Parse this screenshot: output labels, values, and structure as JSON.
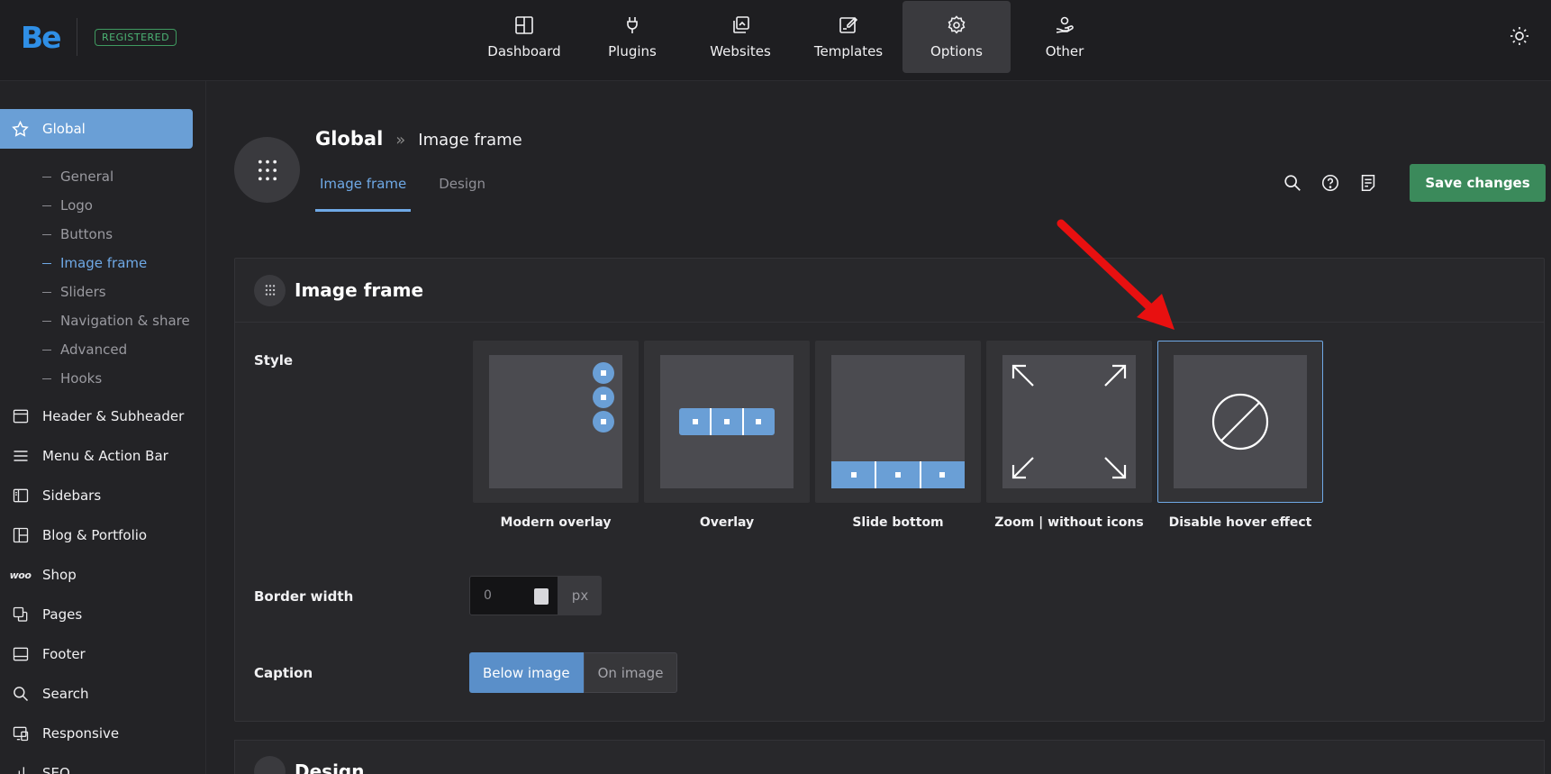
{
  "brand": {
    "logo": "Be",
    "badge": "REGISTERED"
  },
  "nav": [
    {
      "label": "Dashboard",
      "icon": "dashboard-icon"
    },
    {
      "label": "Plugins",
      "icon": "plug-icon"
    },
    {
      "label": "Websites",
      "icon": "websites-icon"
    },
    {
      "label": "Templates",
      "icon": "templates-icon"
    },
    {
      "label": "Options",
      "icon": "gear-icon",
      "active": true
    },
    {
      "label": "Other",
      "icon": "user-hand-icon"
    }
  ],
  "sidebar": {
    "global": {
      "label": "Global",
      "icon": "star-icon"
    },
    "sub_items": [
      "General",
      "Logo",
      "Buttons",
      "Image frame",
      "Sliders",
      "Navigation & share",
      "Advanced",
      "Hooks"
    ],
    "active_sub": "Image frame",
    "items": [
      {
        "label": "Header & Subheader",
        "icon": "header-icon"
      },
      {
        "label": "Menu & Action Bar",
        "icon": "menu-icon"
      },
      {
        "label": "Sidebars",
        "icon": "sidebar-icon"
      },
      {
        "label": "Blog & Portfolio",
        "icon": "layout-icon"
      },
      {
        "label": "Shop",
        "icon": "woo-icon",
        "prefix": "woo"
      },
      {
        "label": "Pages",
        "icon": "pages-icon"
      },
      {
        "label": "Footer",
        "icon": "footer-icon"
      },
      {
        "label": "Search",
        "icon": "search-icon"
      },
      {
        "label": "Responsive",
        "icon": "responsive-icon"
      },
      {
        "label": "SEO",
        "icon": "seo-icon"
      }
    ]
  },
  "header": {
    "breadcrumb_main": "Global",
    "breadcrumb_sep": "»",
    "breadcrumb_sub": "Image frame",
    "tabs": [
      {
        "label": "Image frame",
        "active": true
      },
      {
        "label": "Design"
      }
    ],
    "save_label": "Save changes"
  },
  "card": {
    "title": "Image frame",
    "style_label": "Style",
    "styles": [
      {
        "label": "Modern overlay"
      },
      {
        "label": "Overlay"
      },
      {
        "label": "Slide bottom"
      },
      {
        "label": "Zoom | without icons"
      },
      {
        "label": "Disable hover effect",
        "selected": true
      }
    ],
    "border_width_label": "Border width",
    "border_width_value": "0",
    "border_width_unit": "px",
    "caption_label": "Caption",
    "caption_options": [
      "Below image",
      "On image"
    ],
    "caption_selected": "Below image"
  },
  "card2": {
    "title": "Design"
  },
  "colors": {
    "accent": "#6fa9e6",
    "save": "#3b8a5b",
    "badge": "#4cb374",
    "arrow": "#e81010"
  }
}
